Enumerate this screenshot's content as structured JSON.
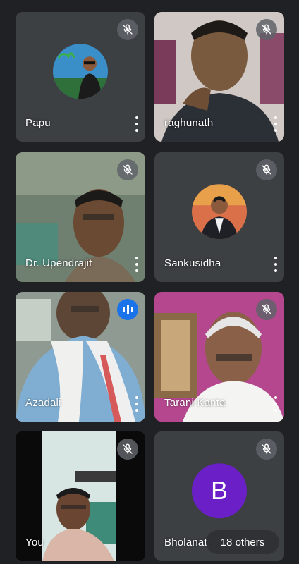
{
  "participants": [
    {
      "name": "Papu",
      "mic_state": "muted",
      "tile_type": "avatar-photo"
    },
    {
      "name": "raghunath",
      "mic_state": "muted",
      "tile_type": "video"
    },
    {
      "name": "Dr. Upendrajit",
      "mic_state": "muted",
      "tile_type": "video"
    },
    {
      "name": "Sankusidha",
      "mic_state": "muted",
      "tile_type": "avatar-photo"
    },
    {
      "name": "Azadali",
      "mic_state": "speaking",
      "tile_type": "video"
    },
    {
      "name": "Tarani Kanta",
      "mic_state": "muted",
      "tile_type": "video"
    },
    {
      "name": "You",
      "mic_state": "muted",
      "tile_type": "video"
    },
    {
      "name": "Bholanath",
      "mic_state": "muted",
      "tile_type": "letter-avatar",
      "avatar_letter": "B"
    }
  ],
  "others_label": "18 others",
  "colors": {
    "background": "#202124",
    "tile": "#3c4043",
    "letter_avatar": "#6a1fc7",
    "speaking": "#1a73e8"
  },
  "icons": {
    "mute": "mic-off-icon",
    "speaking": "audio-level-icon",
    "menu": "more-vert-icon"
  }
}
